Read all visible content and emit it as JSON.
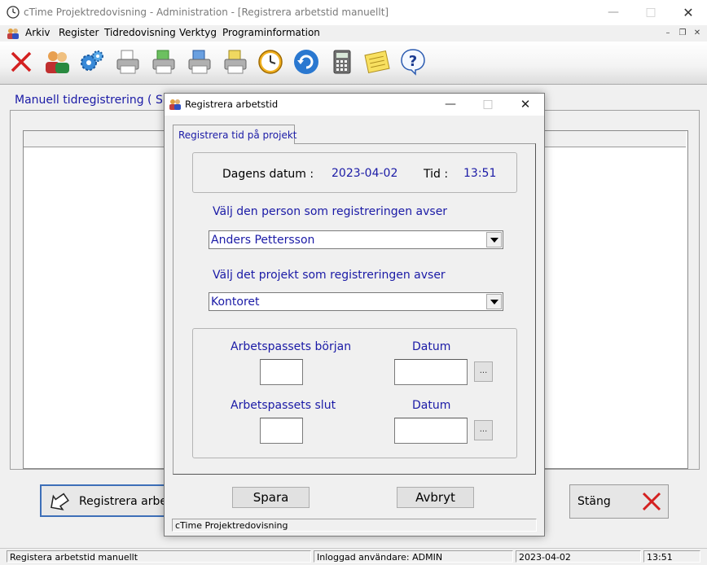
{
  "window": {
    "title": "cTime Projektredovisning - Administration - [Registrera arbetstid manuellt]",
    "icon": "clock-icon"
  },
  "menu": {
    "items": [
      "Arkiv",
      "Register",
      "Tidredovisning",
      "Verktyg",
      "Programinformation"
    ]
  },
  "toolbar": {
    "icons": [
      "close-x-icon",
      "users-icon",
      "gears-icon",
      "printer-document-icon",
      "printer-green-icon",
      "printer-blue-icon",
      "printer-yellow-icon",
      "clock-icon",
      "refresh-icon",
      "calculator-icon",
      "notepad-icon",
      "help-icon"
    ]
  },
  "main": {
    "title": "Manuell tidregistrering ( Ska",
    "register_button": "Registrera arbet",
    "close_button": "Stäng"
  },
  "statusbar": {
    "action": "Registera arbetstid manuellt",
    "user": "Inloggad användare: ADMIN",
    "date": "2023-04-02",
    "time": "13:51"
  },
  "dialog": {
    "title": "Registrera arbetstid",
    "tab": "Registrera tid på projekt",
    "date_label": "Dagens datum :",
    "date_value": "2023-04-02",
    "time_label": "Tid :",
    "time_value": "13:51",
    "person_prompt": "Välj den person som registreringen avser",
    "person_value": "Anders Pettersson",
    "project_prompt": "Välj det projekt som registreringen avser",
    "project_value": "Kontoret",
    "start_label": "Arbetspassets början",
    "end_label": "Arbetspassets slut",
    "date_col_label": "Datum",
    "date_col_label_2": "Datum",
    "dots": "...",
    "save_button": "Spara",
    "cancel_button": "Avbryt",
    "status": "cTime Projektredovisning"
  },
  "colors": {
    "accent_text": "#1a1aa6",
    "close_red": "#d42020",
    "focus_border": "#3d6fb8"
  }
}
